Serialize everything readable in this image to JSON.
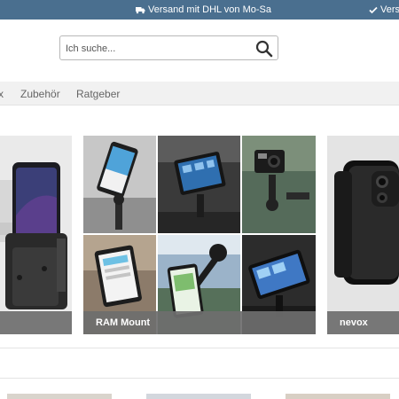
{
  "topbar": {
    "shipping": "Versand mit DHL von Mo-Sa",
    "shipping_icon": "truck-icon",
    "second": "Versa",
    "second_icon": "check-icon",
    "background": "#4a6f8f"
  },
  "search": {
    "placeholder": "Ich suche...",
    "icon": "search-icon"
  },
  "nav": {
    "items": [
      "x",
      "Zubehör",
      "Ratgeber"
    ]
  },
  "brands": [
    {
      "label": ""
    },
    {
      "label": "RAM Mount"
    },
    {
      "label": "nevox"
    }
  ]
}
